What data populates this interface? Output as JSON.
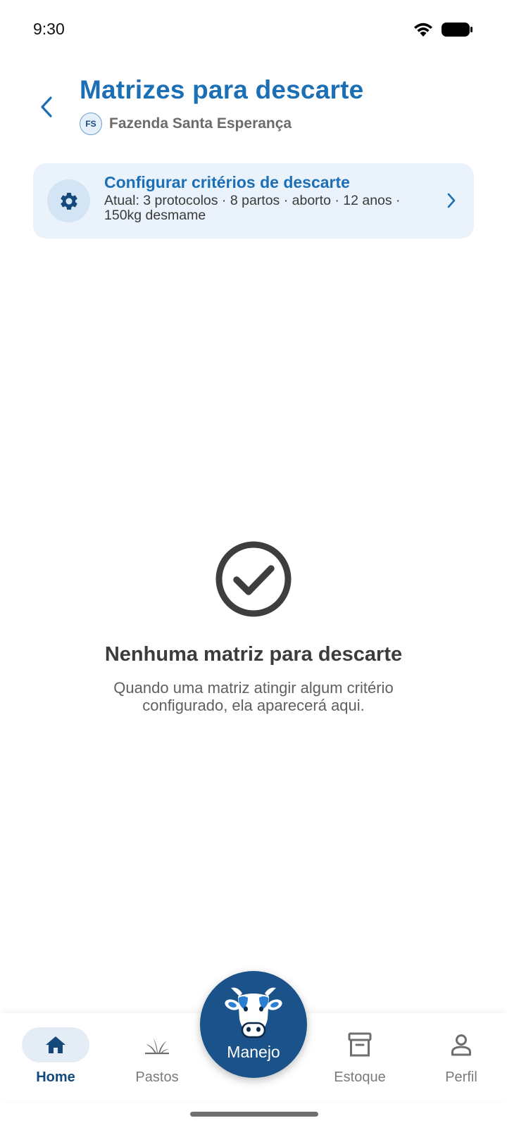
{
  "status_bar": {
    "time": "9:30"
  },
  "header": {
    "title": "Matrizes para descarte",
    "farm_initials": "FS",
    "farm_name": "Fazenda Santa Esperança"
  },
  "config_card": {
    "title": "Configurar critérios de descarte",
    "subtitle": "Atual: 3 protocolos · 8 partos · aborto · 12 anos · 150kg desmame"
  },
  "empty_state": {
    "title": "Nenhuma matriz para descarte",
    "message": "Quando uma matriz atingir algum critério configurado, ela aparecerá aqui."
  },
  "bottom_nav": {
    "items": [
      {
        "label": "Home",
        "icon": "home-icon",
        "active": true
      },
      {
        "label": "Pastos",
        "icon": "grass-icon",
        "active": false
      },
      {
        "label": "Estoque",
        "icon": "archive-box-icon",
        "active": false
      },
      {
        "label": "Perfil",
        "icon": "person-icon",
        "active": false
      }
    ],
    "fab_label": "Manejo",
    "fab_icon": "cow-icon"
  },
  "colors": {
    "primary": "#1d6fb5",
    "primary_dark": "#15487b",
    "fab": "#1b5289",
    "card_bg": "#eaf3fb"
  }
}
